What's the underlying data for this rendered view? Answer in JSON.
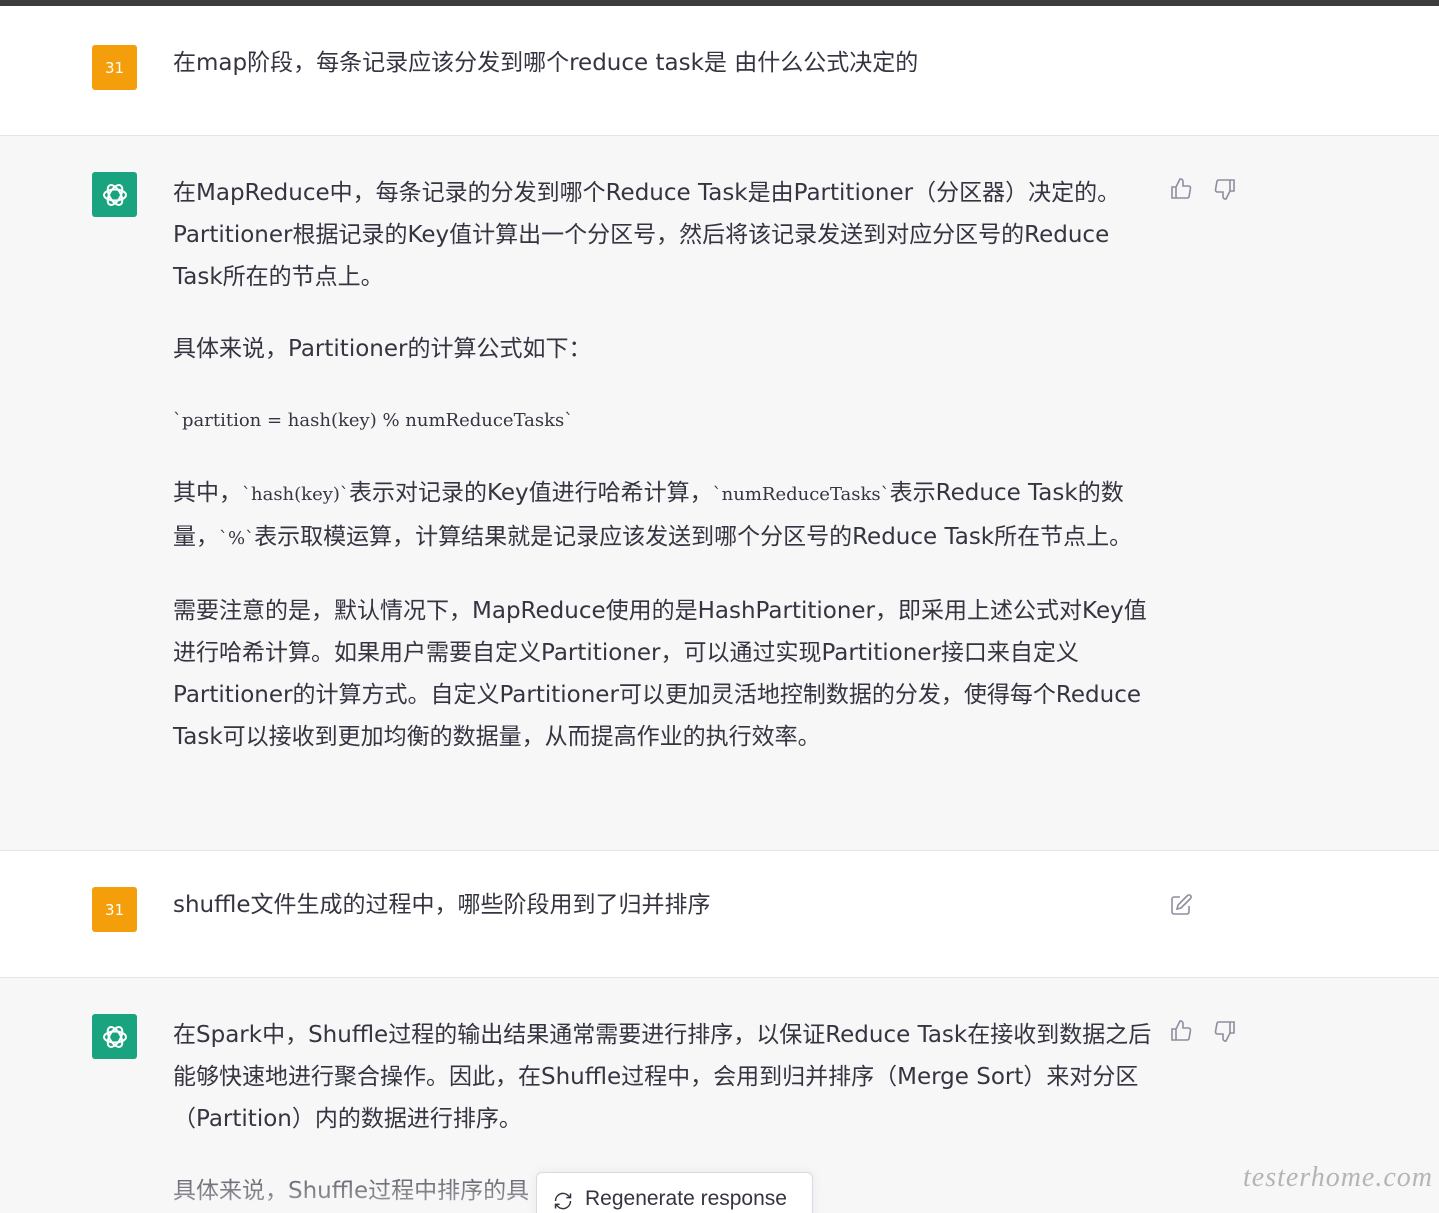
{
  "messages": [
    {
      "role": "user",
      "avatar": "31",
      "text": "在map阶段，每条记录应该分发到哪个reduce task是 由什么公式决定的"
    },
    {
      "role": "assistant",
      "p1": "在MapReduce中，每条记录的分发到哪个Reduce Task是由Partitioner（分区器）决定的。Partitioner根据记录的Key值计算出一个分区号，然后将该记录发送到对应分区号的Reduce Task所在的节点上。",
      "p2": "具体来说，Partitioner的计算公式如下：",
      "formula": "`partition = hash(key) % numReduceTasks`",
      "p3_a": "其中，",
      "p3_code1": "`hash(key)`",
      "p3_b": "表示对记录的Key值进行哈希计算，",
      "p3_code2": "`numReduceTasks`",
      "p3_c": "表示Reduce Task的数量，",
      "p3_code3": "`%`",
      "p3_d": "表示取模运算，计算结果就是记录应该发送到哪个分区号的Reduce Task所在节点上。",
      "p4": "需要注意的是，默认情况下，MapReduce使用的是HashPartitioner，即采用上述公式对Key值进行哈希计算。如果用户需要自定义Partitioner，可以通过实现Partitioner接口来自定义Partitioner的计算方式。自定义Partitioner可以更加灵活地控制数据的分发，使得每个Reduce Task可以接收到更加均衡的数据量，从而提高作业的执行效率。"
    },
    {
      "role": "user",
      "avatar": "31",
      "text": "shuffle文件生成的过程中，哪些阶段用到了归并排序"
    },
    {
      "role": "assistant",
      "p1": "在Spark中，Shuffle过程的输出结果通常需要进行排序，以保证Reduce Task在接收到数据之后能够快速地进行聚合操作。因此，在Shuffle过程中，会用到归并排序（Merge Sort）来对分区（Partition）内的数据进行排序。",
      "p2": "具体来说，Shuffle过程中排序的具"
    }
  ],
  "regenerate_label": "Regenerate response",
  "watermark": "testerhome.com",
  "icons": {
    "like": "thumbs-up-icon",
    "dislike": "thumbs-down-icon",
    "edit": "edit-icon",
    "regenerate": "refresh-icon",
    "assistant_logo": "openai-logo-icon"
  },
  "colors": {
    "user_avatar": "#f59e0b",
    "assistant_avatar": "#19a37e",
    "assistant_bg": "#f7f7f8"
  }
}
